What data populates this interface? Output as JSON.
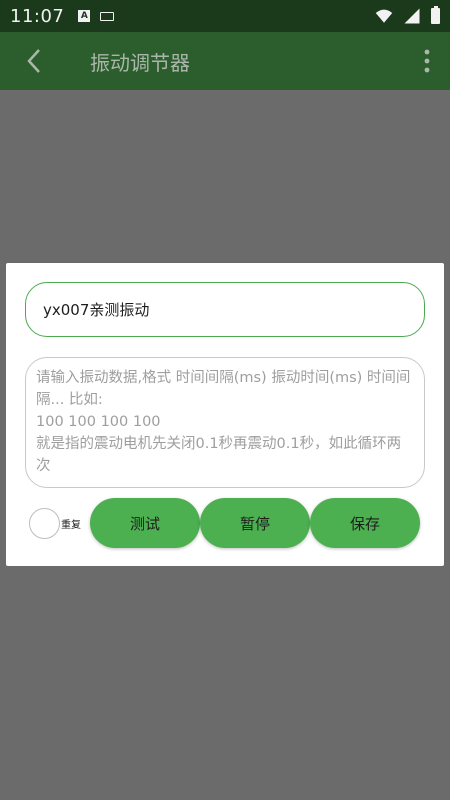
{
  "status_bar": {
    "time": "11:07",
    "icons": [
      "a-notification-icon",
      "keyboard-icon",
      "wifi-icon",
      "signal-icon",
      "battery-charging-icon"
    ]
  },
  "toolbar": {
    "title": "振动调节器",
    "back_icon": "chevron-left-icon",
    "more_icon": "more-vert-icon"
  },
  "dialog": {
    "name_input": {
      "value": "yx007亲测振动"
    },
    "data_input": {
      "value": "",
      "placeholder": "请输入振动数据,格式 时间间隔(ms) 振动时间(ms) 时间间隔... 比如:\n100 100 100 100\n就是指的震动电机先关闭0.1秒再震动0.1秒，如此循环两次"
    },
    "repeat": {
      "label": "重复",
      "checked": false
    },
    "buttons": {
      "test": "测试",
      "pause": "暂停",
      "save": "保存"
    }
  },
  "colors": {
    "accent": "#4caf50",
    "scrim": "#6b6b6b",
    "toolbar_dimmed": "#2c5e2d"
  }
}
